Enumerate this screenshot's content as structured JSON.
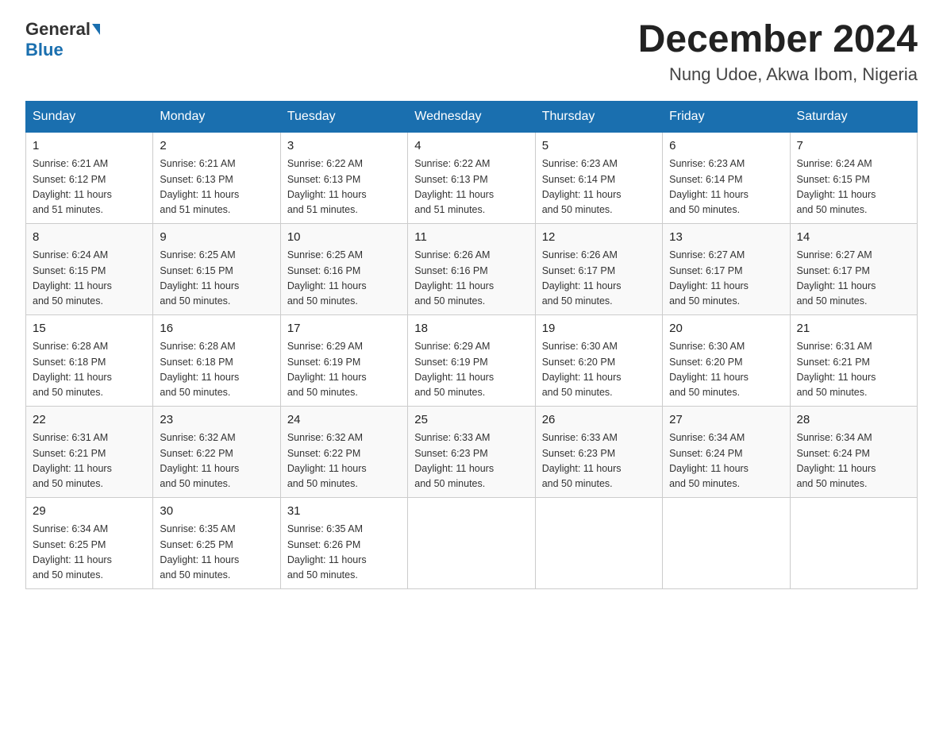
{
  "logo": {
    "general": "General",
    "blue": "Blue"
  },
  "header": {
    "title": "December 2024",
    "location": "Nung Udoe, Akwa Ibom, Nigeria"
  },
  "days_of_week": [
    "Sunday",
    "Monday",
    "Tuesday",
    "Wednesday",
    "Thursday",
    "Friday",
    "Saturday"
  ],
  "weeks": [
    [
      {
        "day": "1",
        "sunrise": "6:21 AM",
        "sunset": "6:12 PM",
        "daylight": "11 hours and 51 minutes."
      },
      {
        "day": "2",
        "sunrise": "6:21 AM",
        "sunset": "6:13 PM",
        "daylight": "11 hours and 51 minutes."
      },
      {
        "day": "3",
        "sunrise": "6:22 AM",
        "sunset": "6:13 PM",
        "daylight": "11 hours and 51 minutes."
      },
      {
        "day": "4",
        "sunrise": "6:22 AM",
        "sunset": "6:13 PM",
        "daylight": "11 hours and 51 minutes."
      },
      {
        "day": "5",
        "sunrise": "6:23 AM",
        "sunset": "6:14 PM",
        "daylight": "11 hours and 50 minutes."
      },
      {
        "day": "6",
        "sunrise": "6:23 AM",
        "sunset": "6:14 PM",
        "daylight": "11 hours and 50 minutes."
      },
      {
        "day": "7",
        "sunrise": "6:24 AM",
        "sunset": "6:15 PM",
        "daylight": "11 hours and 50 minutes."
      }
    ],
    [
      {
        "day": "8",
        "sunrise": "6:24 AM",
        "sunset": "6:15 PM",
        "daylight": "11 hours and 50 minutes."
      },
      {
        "day": "9",
        "sunrise": "6:25 AM",
        "sunset": "6:15 PM",
        "daylight": "11 hours and 50 minutes."
      },
      {
        "day": "10",
        "sunrise": "6:25 AM",
        "sunset": "6:16 PM",
        "daylight": "11 hours and 50 minutes."
      },
      {
        "day": "11",
        "sunrise": "6:26 AM",
        "sunset": "6:16 PM",
        "daylight": "11 hours and 50 minutes."
      },
      {
        "day": "12",
        "sunrise": "6:26 AM",
        "sunset": "6:17 PM",
        "daylight": "11 hours and 50 minutes."
      },
      {
        "day": "13",
        "sunrise": "6:27 AM",
        "sunset": "6:17 PM",
        "daylight": "11 hours and 50 minutes."
      },
      {
        "day": "14",
        "sunrise": "6:27 AM",
        "sunset": "6:17 PM",
        "daylight": "11 hours and 50 minutes."
      }
    ],
    [
      {
        "day": "15",
        "sunrise": "6:28 AM",
        "sunset": "6:18 PM",
        "daylight": "11 hours and 50 minutes."
      },
      {
        "day": "16",
        "sunrise": "6:28 AM",
        "sunset": "6:18 PM",
        "daylight": "11 hours and 50 minutes."
      },
      {
        "day": "17",
        "sunrise": "6:29 AM",
        "sunset": "6:19 PM",
        "daylight": "11 hours and 50 minutes."
      },
      {
        "day": "18",
        "sunrise": "6:29 AM",
        "sunset": "6:19 PM",
        "daylight": "11 hours and 50 minutes."
      },
      {
        "day": "19",
        "sunrise": "6:30 AM",
        "sunset": "6:20 PM",
        "daylight": "11 hours and 50 minutes."
      },
      {
        "day": "20",
        "sunrise": "6:30 AM",
        "sunset": "6:20 PM",
        "daylight": "11 hours and 50 minutes."
      },
      {
        "day": "21",
        "sunrise": "6:31 AM",
        "sunset": "6:21 PM",
        "daylight": "11 hours and 50 minutes."
      }
    ],
    [
      {
        "day": "22",
        "sunrise": "6:31 AM",
        "sunset": "6:21 PM",
        "daylight": "11 hours and 50 minutes."
      },
      {
        "day": "23",
        "sunrise": "6:32 AM",
        "sunset": "6:22 PM",
        "daylight": "11 hours and 50 minutes."
      },
      {
        "day": "24",
        "sunrise": "6:32 AM",
        "sunset": "6:22 PM",
        "daylight": "11 hours and 50 minutes."
      },
      {
        "day": "25",
        "sunrise": "6:33 AM",
        "sunset": "6:23 PM",
        "daylight": "11 hours and 50 minutes."
      },
      {
        "day": "26",
        "sunrise": "6:33 AM",
        "sunset": "6:23 PM",
        "daylight": "11 hours and 50 minutes."
      },
      {
        "day": "27",
        "sunrise": "6:34 AM",
        "sunset": "6:24 PM",
        "daylight": "11 hours and 50 minutes."
      },
      {
        "day": "28",
        "sunrise": "6:34 AM",
        "sunset": "6:24 PM",
        "daylight": "11 hours and 50 minutes."
      }
    ],
    [
      {
        "day": "29",
        "sunrise": "6:34 AM",
        "sunset": "6:25 PM",
        "daylight": "11 hours and 50 minutes."
      },
      {
        "day": "30",
        "sunrise": "6:35 AM",
        "sunset": "6:25 PM",
        "daylight": "11 hours and 50 minutes."
      },
      {
        "day": "31",
        "sunrise": "6:35 AM",
        "sunset": "6:26 PM",
        "daylight": "11 hours and 50 minutes."
      },
      null,
      null,
      null,
      null
    ]
  ],
  "labels": {
    "sunrise": "Sunrise:",
    "sunset": "Sunset:",
    "daylight": "Daylight:"
  }
}
